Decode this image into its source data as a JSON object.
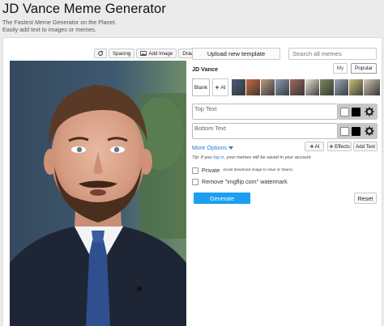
{
  "header": {
    "title": "JD Vance Meme Generator",
    "subtitle": "The Fastest Meme Generator on the Planet. Easily add text to images or memes."
  },
  "toolbar": {
    "rotate_icon": "rotate-icon",
    "spacing_label": "Spacing",
    "add_image_label": "Add Image",
    "draw_label": "Draw"
  },
  "templates": {
    "upload_label": "Upload new template",
    "search_placeholder": "Search all memes",
    "current_name": "JD Vance",
    "tab_my": "My",
    "tab_popular": "Popular",
    "blank_label": "Blank",
    "ai_label": "AI",
    "thumbnails": [
      {
        "name": "template-1",
        "color": "#4a5c7a"
      },
      {
        "name": "template-2",
        "color": "#c96b3a"
      },
      {
        "name": "template-3",
        "color": "#b89a80"
      },
      {
        "name": "template-4",
        "color": "#8a9cb8"
      },
      {
        "name": "template-5",
        "color": "#9b6b5a"
      },
      {
        "name": "template-6",
        "color": "#e8e2d6"
      },
      {
        "name": "template-7",
        "color": "#7a8a5a"
      },
      {
        "name": "template-8",
        "color": "#9aa8b8"
      },
      {
        "name": "template-9",
        "color": "#c7c07a"
      },
      {
        "name": "template-10",
        "color": "#d8c8b8"
      }
    ]
  },
  "text_boxes": {
    "top_placeholder": "Top Text",
    "bottom_placeholder": "Bottom Text"
  },
  "options": {
    "more_options_label": "More Options",
    "ai_button": "AI",
    "effects_button": "Effects",
    "add_text_button": "Add Text",
    "tip_prefix": "Tip: If you",
    "tip_link": "log in",
    "tip_suffix": ", your memes will be saved in your account",
    "private_label": "Private",
    "private_note": "(must download image to save or share)",
    "watermark_label": "Remove \"imgflip.com\" watermark"
  },
  "actions": {
    "generate_label": "Generate",
    "reset_label": "Reset"
  },
  "colors": {
    "accent": "#1a9ff1",
    "link": "#2a7ad6"
  }
}
